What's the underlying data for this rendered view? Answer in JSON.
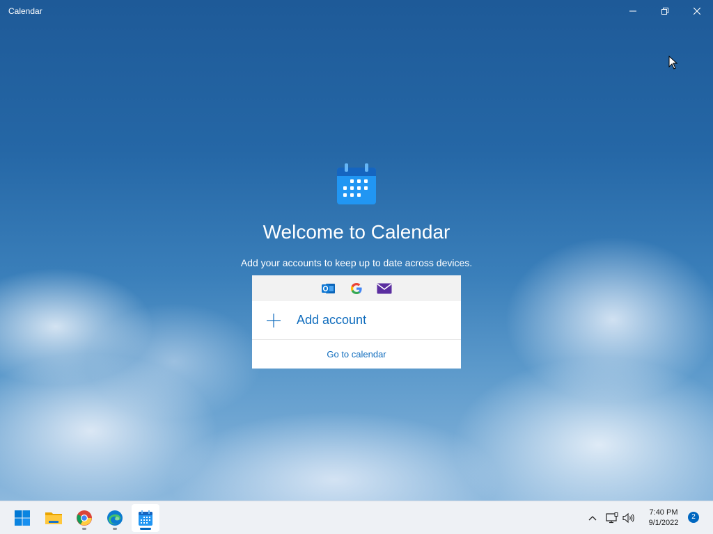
{
  "window": {
    "title": "Calendar",
    "controls": {
      "minimize": "minimize",
      "maximize": "restore",
      "close": "close"
    }
  },
  "welcome": {
    "title": "Welcome to Calendar",
    "subtitle": "Add your accounts to keep up to date across devices.",
    "providers": [
      "outlook-icon",
      "google-icon",
      "mail-icon"
    ],
    "add_account_label": "Add account",
    "go_to_calendar_label": "Go to calendar"
  },
  "taskbar": {
    "apps": [
      "start-icon",
      "file-explorer-icon",
      "chrome-icon",
      "edge-icon",
      "calendar-app-icon"
    ],
    "active_app": "Calendar",
    "time": "7:40 PM",
    "date": "9/1/2022",
    "notification_count": "2"
  },
  "colors": {
    "accent": "#0f6cbd",
    "calendar_icon_blue": "#1e88e5",
    "taskbar_bg": "#eef1f5"
  }
}
